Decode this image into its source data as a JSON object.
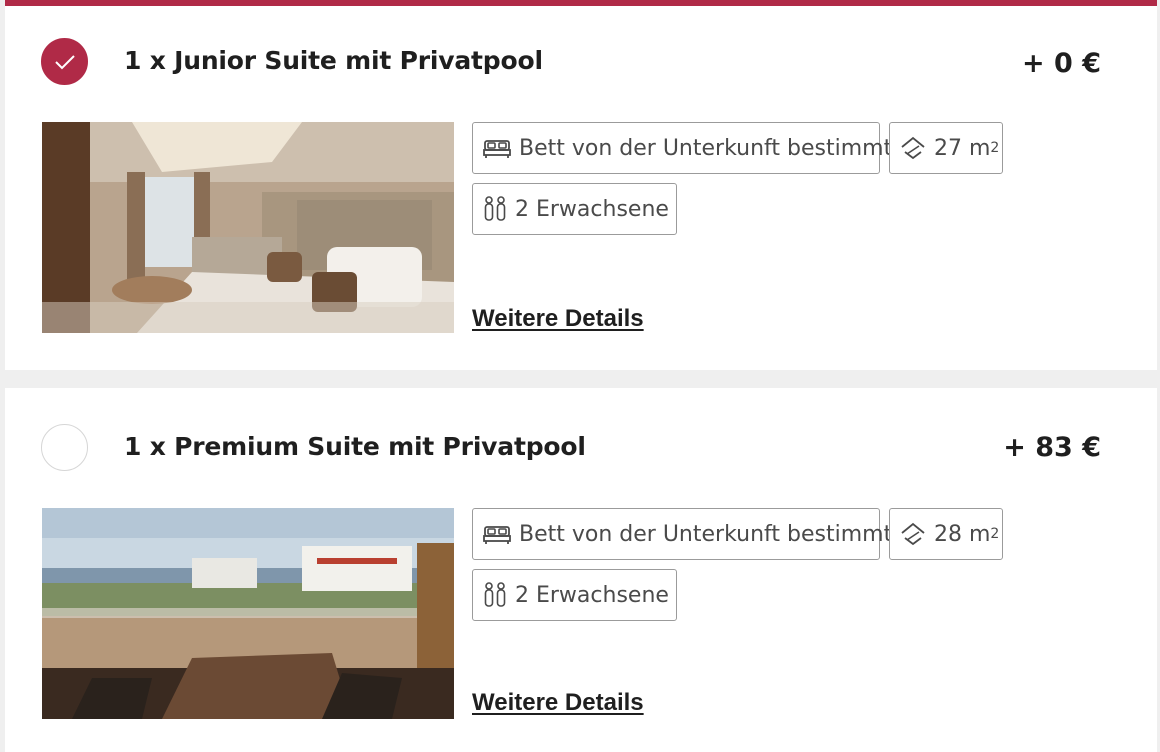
{
  "accent_color": "#b02a47",
  "rooms": [
    {
      "title": "1 x Junior Suite mit Privatpool",
      "price": "+ 0 €",
      "selected": true,
      "bed": "Bett von der Unterkunft bestimmt",
      "size_value": "27 m",
      "size_unit": "2",
      "guests": "2 Erwachsene",
      "details_link": "Weitere Details",
      "photo": "bedroom-photo"
    },
    {
      "title": "1 x Premium Suite mit Privatpool",
      "price": "+ 83 €",
      "selected": false,
      "bed": "Bett von der Unterkunft bestimmt",
      "size_value": "28 m",
      "size_unit": "2",
      "guests": "2 Erwachsene",
      "details_link": "Weitere Details",
      "photo": "terrace-sea-view-photo"
    }
  ],
  "icons": {
    "selected": "checkmark-icon",
    "bed": "bed-icon",
    "size": "room-size-icon",
    "guests": "guests-icon"
  }
}
